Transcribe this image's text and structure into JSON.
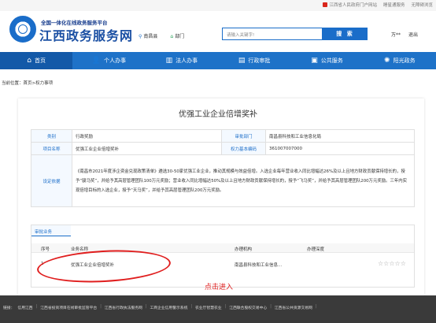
{
  "topbar": {
    "portal_link": "江西省人民政府门户网站",
    "links": [
      "睡星通服务",
      "无障碍浏览"
    ]
  },
  "header": {
    "brand_sub": "全国一体化在线政务服务平台",
    "brand_main": "江西政务服务网",
    "location": "南昌县",
    "department": "部门",
    "search_placeholder": "请输入关键字!",
    "search_button": "搜 索",
    "user_name": "万**",
    "logout": "退出"
  },
  "nav": {
    "items": [
      {
        "label": "首页",
        "icon": "home-icon",
        "glyph": "⌂"
      },
      {
        "label": "个人办事",
        "icon": "person-icon",
        "glyph": "👤"
      },
      {
        "label": "法人办事",
        "icon": "building-icon",
        "glyph": "▥"
      },
      {
        "label": "行政审批",
        "icon": "stamp-icon",
        "glyph": "▤"
      },
      {
        "label": "公共服务",
        "icon": "service-icon",
        "glyph": "▣"
      },
      {
        "label": "阳光政务",
        "icon": "sun-icon",
        "glyph": "✺"
      }
    ],
    "active_index": 0
  },
  "breadcrumb": "当前位置：首页>权力事项",
  "page_title": "优强工业企业倍增奖补",
  "info": {
    "category_label": "类别",
    "category_value": "行政奖励",
    "dept_label": "审批部门",
    "dept_value": "南昌县科技和工业信息化局",
    "item_label": "项目名称",
    "item_value": "优强工业企业倍增奖补",
    "code_label": "权力基本编码",
    "code_value": "361007007000",
    "basis_label": "设定依据",
    "basis_value": "《南昌市2021年度涉企资金兑现政策清单》遴选30-50家优强工业企业，推动其规模与效益倍增。入选企业每年营业收入同比增幅达26%及以上且地方财政贡献保持增长的，授予“骏马奖”，并给予其高层管理团队100万元奖励；营业收入同比增幅达50%及以上且地方财政贡献保持增长的，授予“飞马奖”，并给予其高层管理团队200万元奖励。三年内实现倍增目标的入选企业，授予“天马奖”，并给予其高层管理团队200万元奖励。"
  },
  "business": {
    "tab": "审批业务",
    "headers": {
      "no": "序号",
      "name": "业务名称",
      "org": "办理机构",
      "depth": "办理深度"
    },
    "rows": [
      {
        "no": "1",
        "name": "优强工业企业倍增奖补",
        "org": "南昌县科技和工业信息...",
        "stars": "☆☆☆☆☆"
      }
    ]
  },
  "annotation": "点击进入",
  "footer": {
    "links": [
      "链接：",
      "信用江西",
      "江西省投资项目在线审批监管平台",
      "江西省行政执法服务网",
      "工商企业信用警示系统",
      "农业厅智慧农业",
      "江西联合股权交易中心",
      "江西省公共资源交易网"
    ]
  }
}
